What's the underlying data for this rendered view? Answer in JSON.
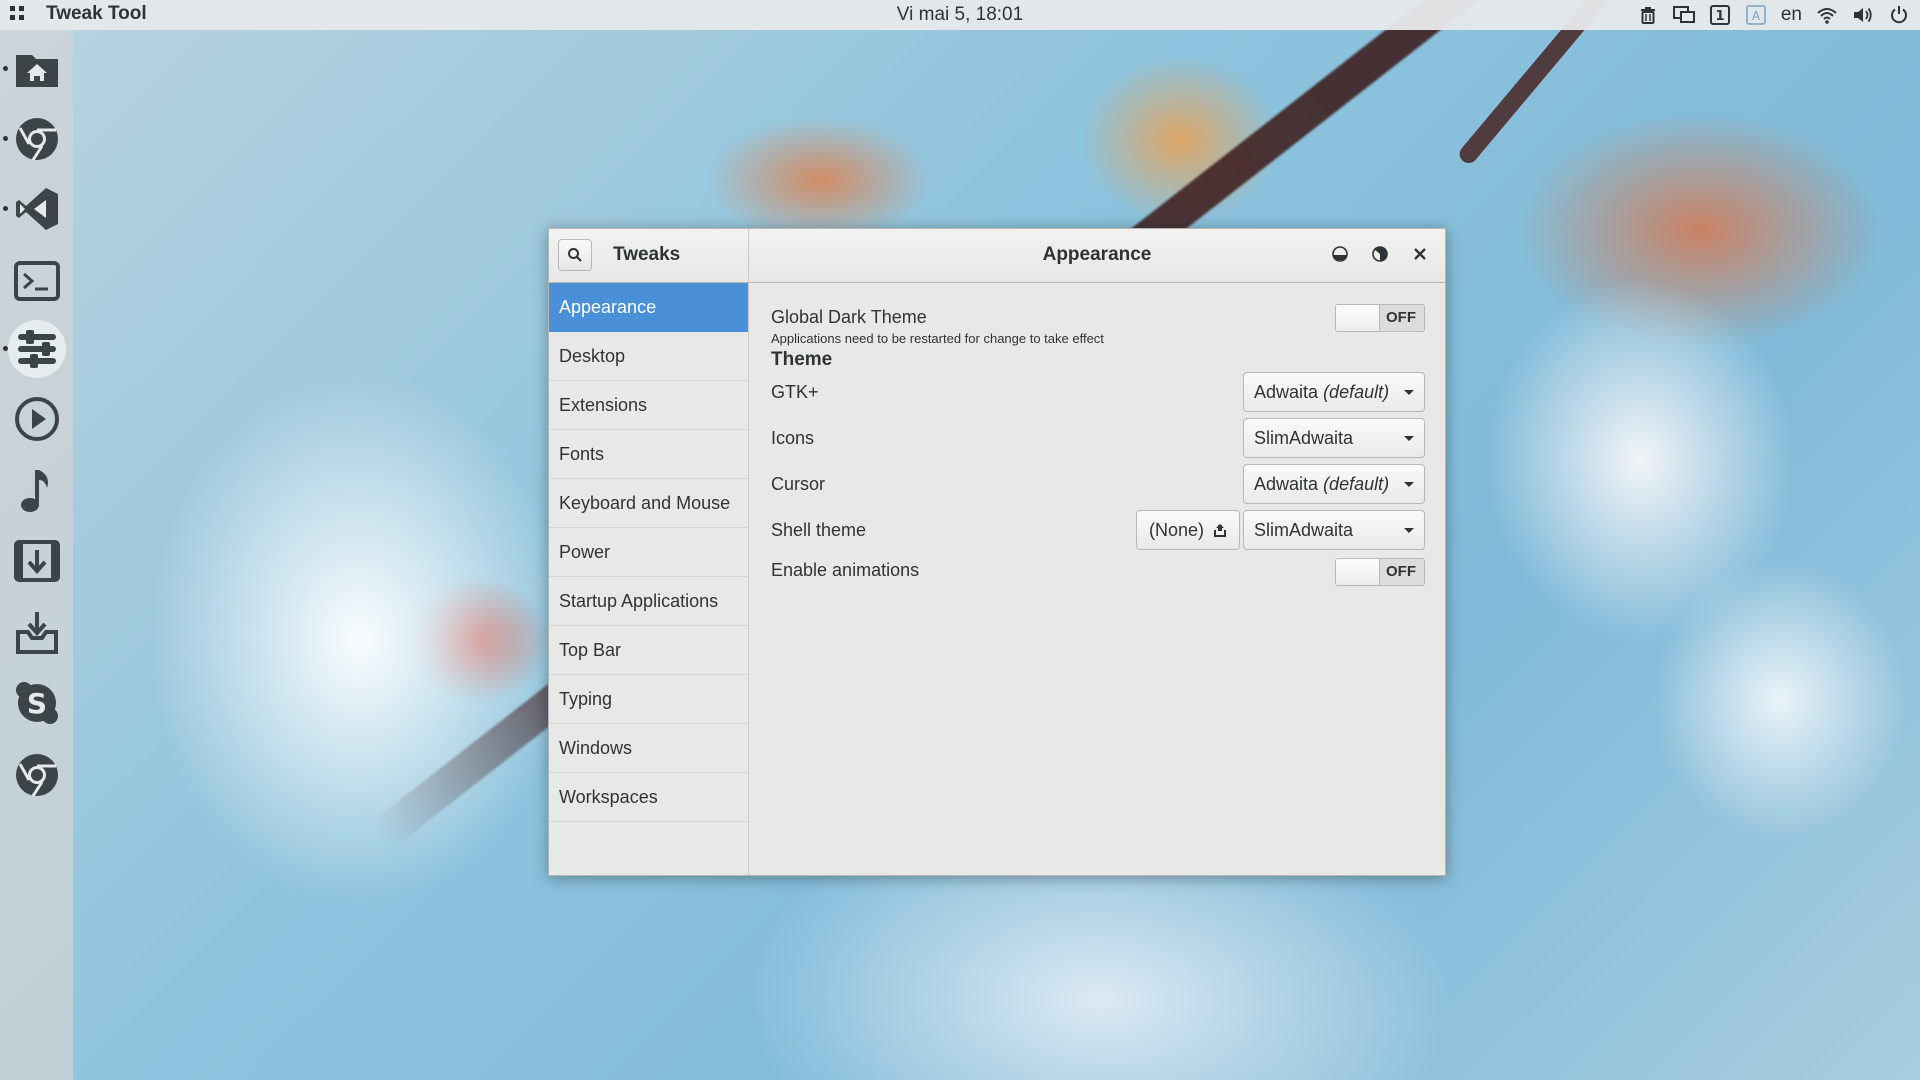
{
  "topbar": {
    "app_name": "Tweak Tool",
    "clock": "Vi mai  5, 18:01",
    "language": "en",
    "tray_icons": [
      "trash-icon",
      "display-icon",
      "workspace-1-icon",
      "input-a-icon",
      "wifi-icon",
      "volume-icon",
      "power-icon"
    ],
    "workspace_number": "1",
    "input_letter": "A"
  },
  "dock": {
    "items": [
      {
        "name": "files",
        "icon": "home-folder-icon",
        "running": true
      },
      {
        "name": "chrome",
        "icon": "chrome-icon",
        "running": true
      },
      {
        "name": "visual-studio-code",
        "icon": "vscode-icon",
        "running": true
      },
      {
        "name": "terminal",
        "icon": "terminal-icon",
        "running": false
      },
      {
        "name": "tweak-tool",
        "icon": "tweaks-icon",
        "running": true,
        "active": true
      },
      {
        "name": "media-player",
        "icon": "play-icon",
        "running": false
      },
      {
        "name": "music",
        "icon": "music-note-icon",
        "running": false
      },
      {
        "name": "video-downloader",
        "icon": "film-download-icon",
        "running": false
      },
      {
        "name": "software-installer",
        "icon": "install-icon",
        "running": false
      },
      {
        "name": "skype",
        "icon": "skype-icon",
        "running": false
      },
      {
        "name": "chromium",
        "icon": "chromium-icon",
        "running": false
      }
    ]
  },
  "window": {
    "sidebar_title": "Tweaks",
    "title": "Appearance",
    "sidebar_items": [
      {
        "label": "Appearance",
        "selected": true
      },
      {
        "label": "Desktop"
      },
      {
        "label": "Extensions"
      },
      {
        "label": "Fonts"
      },
      {
        "label": "Keyboard and Mouse"
      },
      {
        "label": "Power"
      },
      {
        "label": "Startup Applications"
      },
      {
        "label": "Top Bar"
      },
      {
        "label": "Typing"
      },
      {
        "label": "Windows"
      },
      {
        "label": "Workspaces"
      }
    ],
    "content": {
      "global_dark_theme": {
        "label": "Global Dark Theme",
        "note": "Applications need to be restarted for change to take effect",
        "state": "OFF"
      },
      "theme_section": "Theme",
      "gtk": {
        "label": "GTK+",
        "value": "Adwaita",
        "suffix": "(default)"
      },
      "icons": {
        "label": "Icons",
        "value": "SlimAdwaita"
      },
      "cursor": {
        "label": "Cursor",
        "value": "Adwaita",
        "suffix": "(default)"
      },
      "shell_theme": {
        "label": "Shell theme",
        "file_button": "(None)",
        "value": "SlimAdwaita"
      },
      "animations": {
        "label": "Enable animations",
        "state": "OFF"
      }
    }
  },
  "colors": {
    "accent": "#4a90d9",
    "window_bg": "#e8e8e7",
    "text": "#2e3436"
  }
}
